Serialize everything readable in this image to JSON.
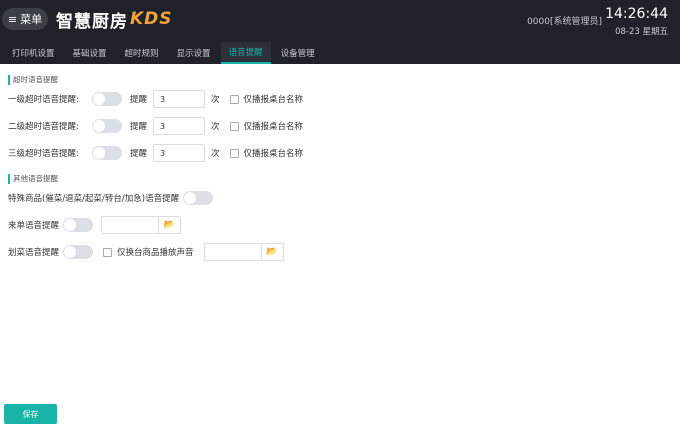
{
  "header": {
    "menu_label": "菜单",
    "menu_icon": "≡",
    "logo_main": "智慧厨房",
    "logo_kds": "KDS",
    "user": "0000[系统管理员]",
    "time": "14:26:44",
    "date": "08-23 星期五"
  },
  "tabs": [
    {
      "label": "打印机设置"
    },
    {
      "label": "基础设置"
    },
    {
      "label": "超时规则"
    },
    {
      "label": "显示设置"
    },
    {
      "label": "语音提醒"
    },
    {
      "label": "设备管理"
    }
  ],
  "timeout_section": {
    "title": "超时语音提醒",
    "rows": [
      {
        "label": "一级超时语音提醒:",
        "remind_label": "提醒",
        "count": "3",
        "unit": "次",
        "checkbox_label": "仅播报桌台名称"
      },
      {
        "label": "二级超时语音提醒:",
        "remind_label": "提醒",
        "count": "3",
        "unit": "次",
        "checkbox_label": "仅播报桌台名称"
      },
      {
        "label": "三级超时语音提醒:",
        "remind_label": "提醒",
        "count": "3",
        "unit": "次",
        "checkbox_label": "仅播报桌台名称"
      }
    ]
  },
  "other_section": {
    "title": "其他语音提醒",
    "special_label": "特殊商品(催菜/退菜/起菜/转台/加急)语音提醒",
    "incoming_label": "来单语音提醒",
    "serve_label": "划菜语音提醒",
    "serve_checkbox_label": "仅换台商品播放声音",
    "folder_icon": "📂"
  },
  "save_label": "保存",
  "colors": {
    "accent": "#15b5ab",
    "header_bg": "#1f2229",
    "logo_kds": "#f2a23a"
  }
}
